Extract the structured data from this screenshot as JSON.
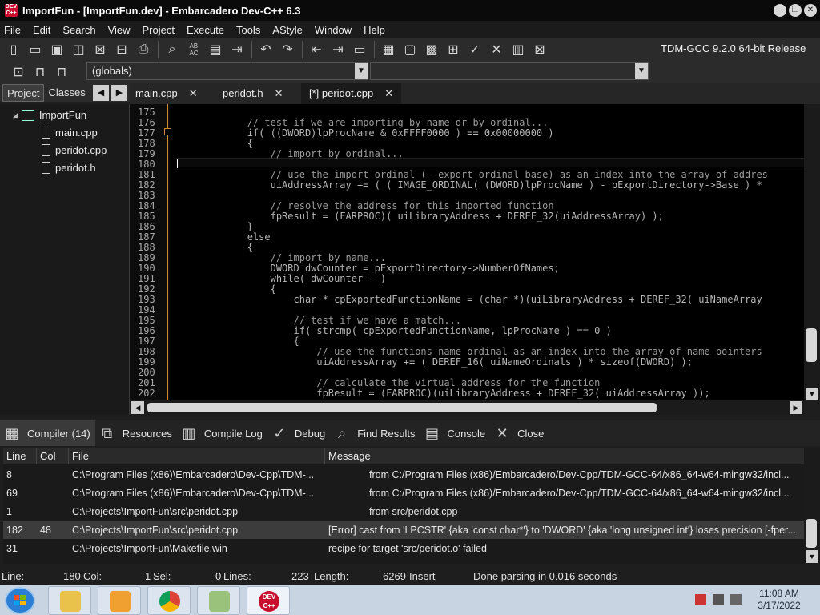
{
  "window": {
    "title": "ImportFun - [ImportFun.dev] - Embarcadero Dev-C++ 6.3",
    "icon_text": "DEV C++"
  },
  "menu": [
    "File",
    "Edit",
    "Search",
    "View",
    "Project",
    "Execute",
    "Tools",
    "AStyle",
    "Window",
    "Help"
  ],
  "toolbar": {
    "compiler": "TDM-GCC 9.2.0 64-bit Release",
    "globals": "(globals)",
    "second_combo": ""
  },
  "left_panel": {
    "tabs": [
      "Project",
      "Classes"
    ],
    "project_name": "ImportFun",
    "files": [
      "main.cpp",
      "peridot.cpp",
      "peridot.h"
    ]
  },
  "editor_tabs": [
    {
      "label": "main.cpp"
    },
    {
      "label": "peridot.h"
    },
    {
      "label": "[*] peridot.cpp"
    }
  ],
  "code": {
    "lines": [
      {
        "n": "175",
        "text": ""
      },
      {
        "n": "176",
        "text": "            // test if we are importing by name or by ordinal...",
        "comment": true
      },
      {
        "n": "177",
        "text": "            if( ((DWORD)lpProcName & 0xFFFF0000 ) == 0x00000000 )"
      },
      {
        "n": "178",
        "text": "            {"
      },
      {
        "n": "179",
        "text": "                // import by ordinal...",
        "comment": true
      },
      {
        "n": "180",
        "text": ""
      },
      {
        "n": "181",
        "text": "                // use the import ordinal (- export ordinal base) as an index into the array of addres",
        "comment": true
      },
      {
        "n": "182",
        "text": "                uiAddressArray += ( ( IMAGE_ORDINAL( (DWORD)lpProcName ) - pExportDirectory->Base ) *"
      },
      {
        "n": "183",
        "text": ""
      },
      {
        "n": "184",
        "text": "                // resolve the address for this imported function",
        "comment": true
      },
      {
        "n": "185",
        "text": "                fpResult = (FARPROC)( uiLibraryAddress + DEREF_32(uiAddressArray) );"
      },
      {
        "n": "186",
        "text": "            }"
      },
      {
        "n": "187",
        "text": "            else"
      },
      {
        "n": "188",
        "text": "            {"
      },
      {
        "n": "189",
        "text": "                // import by name...",
        "comment": true
      },
      {
        "n": "190",
        "text": "                DWORD dwCounter = pExportDirectory->NumberOfNames;"
      },
      {
        "n": "191",
        "text": "                while( dwCounter-- )"
      },
      {
        "n": "192",
        "text": "                {"
      },
      {
        "n": "193",
        "text": "                    char * cpExportedFunctionName = (char *)(uiLibraryAddress + DEREF_32( uiNameArray"
      },
      {
        "n": "194",
        "text": ""
      },
      {
        "n": "195",
        "text": "                    // test if we have a match...",
        "comment": true
      },
      {
        "n": "196",
        "text": "                    if( strcmp( cpExportedFunctionName, lpProcName ) == 0 )"
      },
      {
        "n": "197",
        "text": "                    {"
      },
      {
        "n": "198",
        "text": "                        // use the functions name ordinal as an index into the array of name pointers",
        "comment": true
      },
      {
        "n": "199",
        "text": "                        uiAddressArray += ( DEREF_16( uiNameOrdinals ) * sizeof(DWORD) );"
      },
      {
        "n": "200",
        "text": ""
      },
      {
        "n": "201",
        "text": "                        // calculate the virtual address for the function",
        "comment": true
      },
      {
        "n": "202",
        "text": "                        fpResult = (FARPROC)(uiLibraryAddress + DEREF_32( uiAddressArray ));"
      }
    ]
  },
  "bottom_tabs": [
    {
      "label": "Compiler (14)",
      "icon": "grid-icon"
    },
    {
      "label": "Resources",
      "icon": "resources-icon"
    },
    {
      "label": "Compile Log",
      "icon": "chart-icon"
    },
    {
      "label": "Debug",
      "icon": "check-icon"
    },
    {
      "label": "Find Results",
      "icon": "find-icon"
    },
    {
      "label": "Console",
      "icon": "console-icon"
    },
    {
      "label": "Close",
      "icon": "close-icon"
    }
  ],
  "results": {
    "headers": [
      "Line",
      "Col",
      "File",
      "Message"
    ],
    "rows": [
      {
        "line": "8",
        "col": "",
        "file": "C:\\Program Files (x86)\\Embarcadero\\Dev-Cpp\\TDM-...",
        "message": "from C:/Program Files (x86)/Embarcadero/Dev-Cpp/TDM-GCC-64/x86_64-w64-mingw32/incl...",
        "indent": true
      },
      {
        "line": "69",
        "col": "",
        "file": "C:\\Program Files (x86)\\Embarcadero\\Dev-Cpp\\TDM-...",
        "message": "from C:/Program Files (x86)/Embarcadero/Dev-Cpp/TDM-GCC-64/x86_64-w64-mingw32/incl...",
        "indent": true
      },
      {
        "line": "1",
        "col": "",
        "file": "C:\\Projects\\ImportFun\\src\\peridot.cpp",
        "message": "from src/peridot.cpp",
        "indent": true
      },
      {
        "line": "182",
        "col": "48",
        "file": "C:\\Projects\\ImportFun\\src\\peridot.cpp",
        "message": "[Error] cast from 'LPCSTR' {aka 'const char*'} to 'DWORD' {aka 'long unsigned int'} loses precision [-fper...",
        "indent": false,
        "selected": true
      },
      {
        "line": "31",
        "col": "",
        "file": "C:\\Projects\\ImportFun\\Makefile.win",
        "message": "recipe for target 'src/peridot.o' failed",
        "indent": false
      }
    ]
  },
  "status": {
    "line_label": "Line:",
    "line_value": "180",
    "col_label": "Col:",
    "col_value": "1",
    "sel_label": "Sel:",
    "sel_value": "0",
    "lines_label": "Lines:",
    "lines_value": "223",
    "length_label": "Length:",
    "length_value": "6269",
    "mode": "Insert",
    "message": "Done parsing in 0.016 seconds"
  },
  "taskbar": {
    "time": "11:08 AM",
    "date": "3/17/2022",
    "devcpp_label": "DEV C++"
  }
}
